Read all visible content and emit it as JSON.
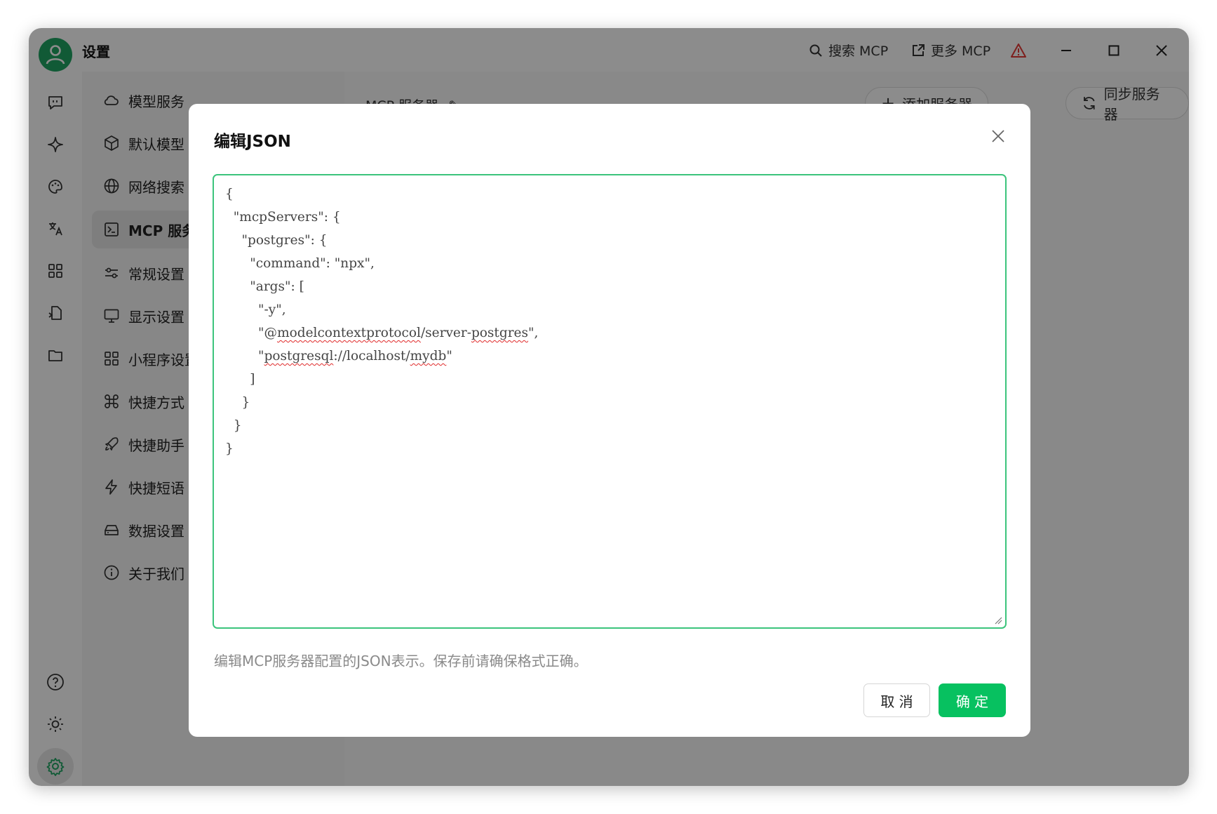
{
  "window": {
    "title": "设置",
    "actions": {
      "search_mcp": "搜索 MCP",
      "more_mcp": "更多 MCP"
    }
  },
  "sidebar": {
    "items": [
      {
        "label": "模型服务",
        "icon": "cloud-icon"
      },
      {
        "label": "默认模型",
        "icon": "cube-icon"
      },
      {
        "label": "网络搜索",
        "icon": "globe-icon"
      },
      {
        "label": "MCP 服务器",
        "icon": "terminal-icon",
        "active": true
      },
      {
        "label": "常规设置",
        "icon": "sliders-icon"
      },
      {
        "label": "显示设置",
        "icon": "monitor-icon"
      },
      {
        "label": "小程序设置",
        "icon": "grid-icon"
      },
      {
        "label": "快捷方式",
        "icon": "command-icon"
      },
      {
        "label": "快捷助手",
        "icon": "rocket-icon"
      },
      {
        "label": "快捷短语",
        "icon": "zap-icon"
      },
      {
        "label": "数据设置",
        "icon": "hard-drive-icon"
      },
      {
        "label": "关于我们",
        "icon": "info-icon"
      }
    ]
  },
  "main": {
    "title": "MCP 服务器",
    "add_server": "添加服务器",
    "sync_servers": "同步服务器"
  },
  "dialog": {
    "title": "编辑JSON",
    "code_lines": [
      "{",
      "  \"mcpServers\": {",
      "    \"postgres\": {",
      "      \"command\": \"npx\",",
      "      \"args\": [",
      "        \"-y\",",
      "        \"@modelcontextprotocol/server-postgres\",",
      "        \"postgresql://localhost/mydb\"",
      "      ]",
      "    }",
      "  }",
      "}"
    ],
    "hint": "编辑MCP服务器配置的JSON表示。保存前请确保格式正确。",
    "cancel": "取 消",
    "confirm": "确 定"
  },
  "colors": {
    "accent": "#07c160",
    "avatar": "#1fa463",
    "focus_border": "#3cc47c",
    "warning": "#e53935"
  }
}
